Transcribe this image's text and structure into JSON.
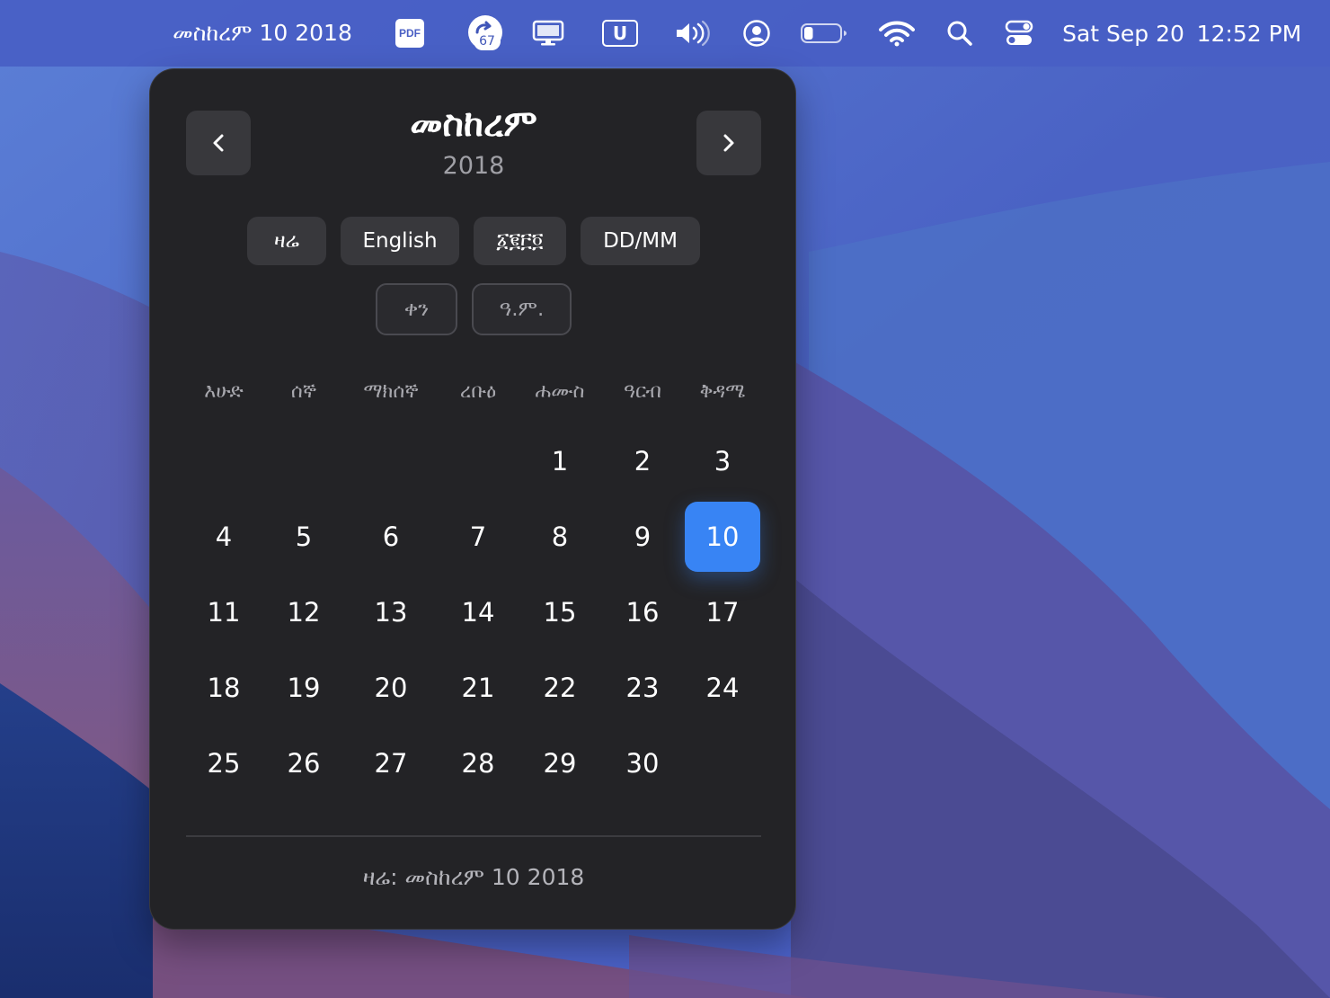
{
  "menubar": {
    "ethiopian_date": "መስከረም 10 2018",
    "pdf_label": "PDF",
    "cloud_badge": "67",
    "u_label": "U",
    "date": "Sat Sep 20",
    "time": "12:52 PM",
    "battery_level": 0.25,
    "icons": [
      "pdf-icon",
      "cloud-sync-icon",
      "display-icon",
      "u-icon",
      "volume-icon",
      "user-account-icon",
      "battery-icon",
      "wifi-icon",
      "search-icon",
      "control-center-icon"
    ]
  },
  "calendar": {
    "month": "መስከረም",
    "year": "2018",
    "prev_label": "‹",
    "next_label": "›",
    "buttons": {
      "today": "ዛሬ",
      "english": "English",
      "geez_numerals": "፩፪፫፬",
      "ddmm": "DD/MM",
      "day": "ቀን",
      "era": "ዓ.ም."
    },
    "weekdays": [
      "እሁድ",
      "ሰኞ",
      "ማክሰኞ",
      "ረቡዕ",
      "ሐሙስ",
      "ዓርብ",
      "ቅዳሜ"
    ],
    "weeks": [
      [
        "",
        "",
        "",
        "",
        "1",
        "2",
        "3"
      ],
      [
        "4",
        "5",
        "6",
        "7",
        "8",
        "9",
        "10"
      ],
      [
        "11",
        "12",
        "13",
        "14",
        "15",
        "16",
        "17"
      ],
      [
        "18",
        "19",
        "20",
        "21",
        "22",
        "23",
        "24"
      ],
      [
        "25",
        "26",
        "27",
        "28",
        "29",
        "30",
        ""
      ]
    ],
    "selected_day": "10",
    "footer": "ዛሬ: መስከረም 10 2018",
    "accent_color": "#3884f4"
  }
}
